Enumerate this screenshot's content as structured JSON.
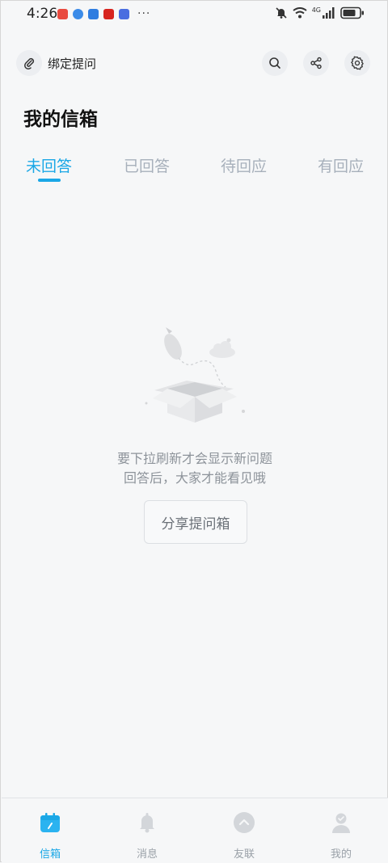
{
  "status_bar": {
    "time": "4:26",
    "more": "···",
    "network": "4G",
    "app_icon_colors": [
      "#e94a3f",
      "#3b8be8",
      "#2f7de0",
      "#d7241f",
      "#4a6de0"
    ]
  },
  "header": {
    "bind_question_label": "绑定提问",
    "title": "我的信箱"
  },
  "tabs": [
    {
      "label": "未回答",
      "active": true
    },
    {
      "label": "已回答",
      "active": false
    },
    {
      "label": "待回应",
      "active": false
    },
    {
      "label": "有回应",
      "active": false
    }
  ],
  "empty_state": {
    "line1": "要下拉刷新才会显示新问题",
    "line2": "回答后，大家才能看见哦",
    "button": "分享提问箱"
  },
  "bottom_nav": [
    {
      "label": "信箱",
      "icon": "calendar-icon",
      "active": true
    },
    {
      "label": "消息",
      "icon": "bell-icon",
      "active": false
    },
    {
      "label": "友联",
      "icon": "chevron-up-circle-icon",
      "active": false
    },
    {
      "label": "我的",
      "icon": "person-icon",
      "active": false
    }
  ],
  "colors": {
    "accent": "#1aa7e6",
    "inactive": "#a7b0bb"
  }
}
